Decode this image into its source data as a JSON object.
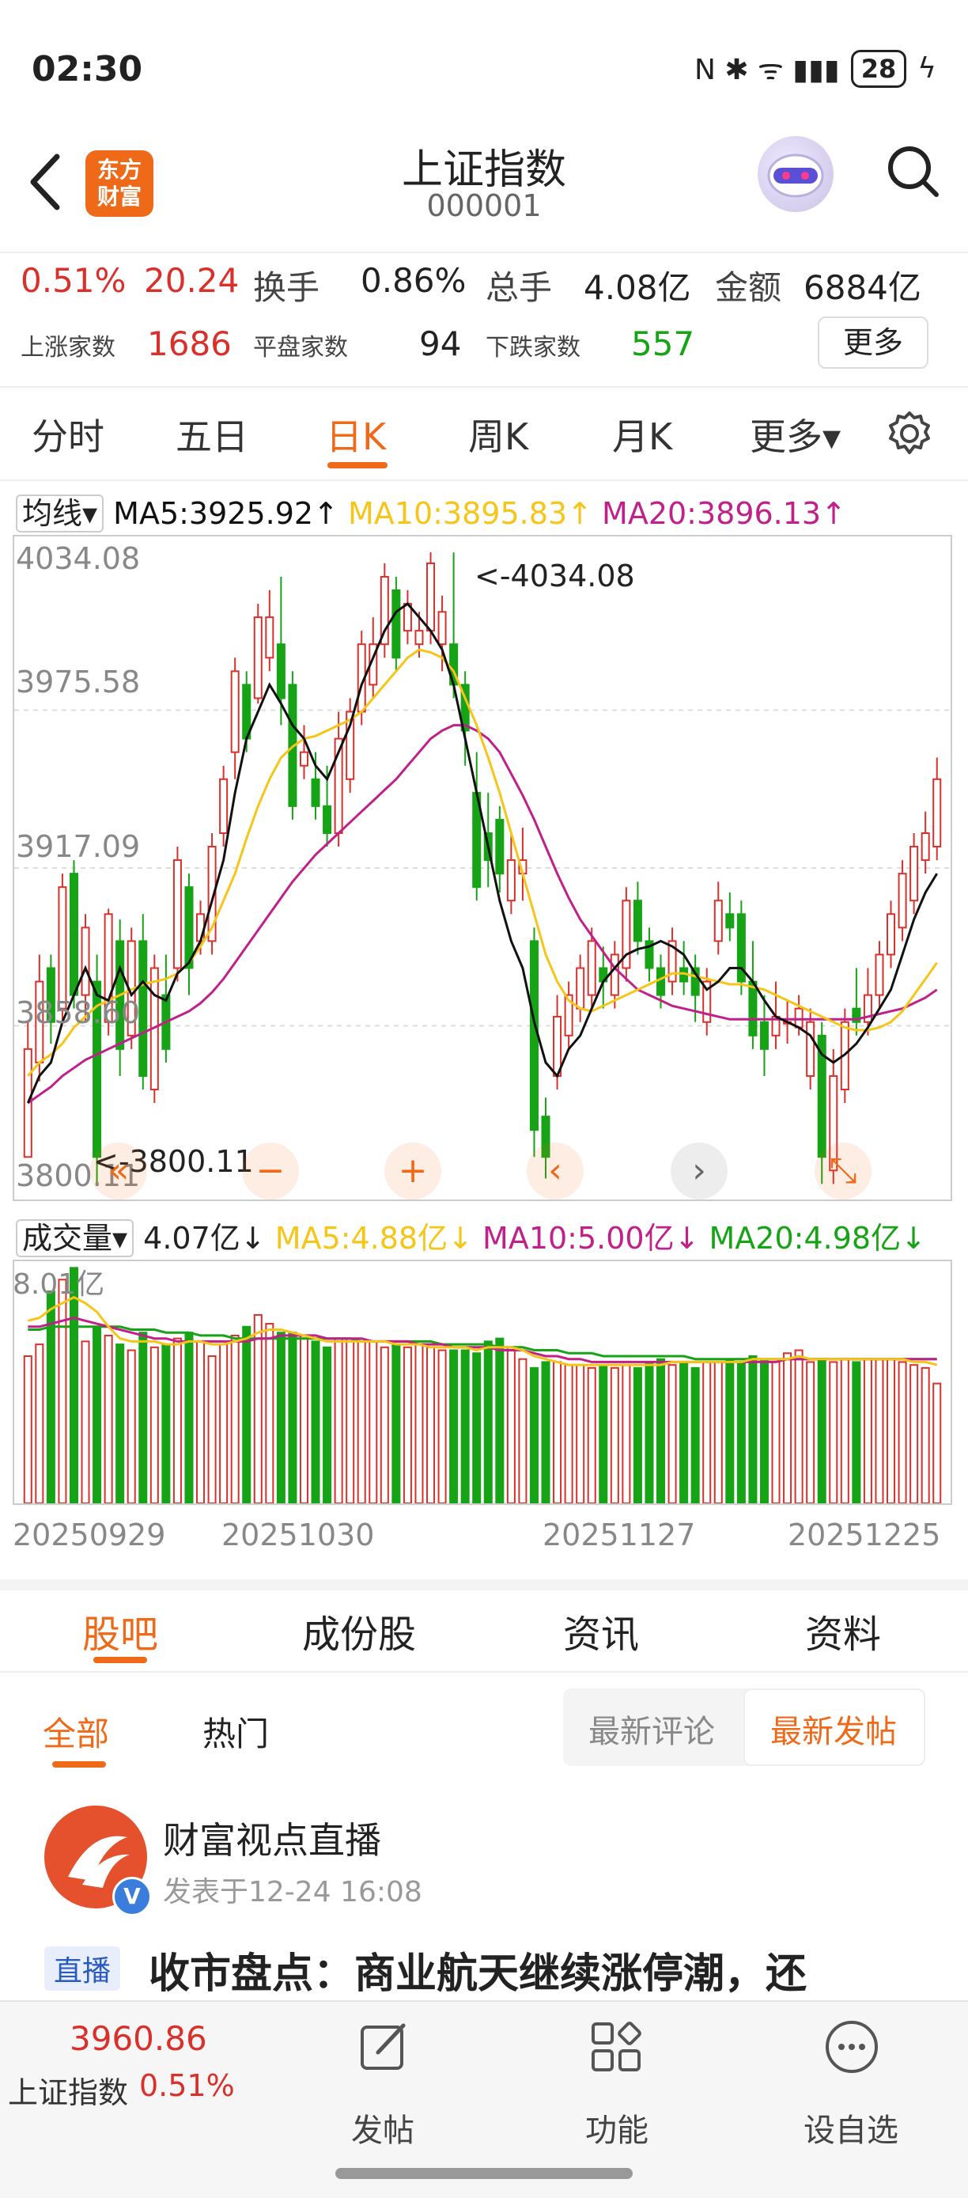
{
  "status_bar": {
    "time": "02:30",
    "signal_icons": "N ✱ ᯤ ▮▮▮",
    "battery": "28",
    "charging": "ϟ"
  },
  "header": {
    "back_icon": "chevron-left-icon",
    "logo_text": "东方\n财富",
    "title": "上证指数",
    "code": "000001"
  },
  "stats": {
    "change_pct": "0.51%",
    "change_val": "20.24",
    "turnover_label": "换手",
    "turnover": "0.86%",
    "volume_label": "总手",
    "volume": "4.08亿",
    "amount_label": "金额",
    "amount": "6884亿",
    "up_label": "上涨家数",
    "up_count": "1686",
    "flat_label": "平盘家数",
    "flat_count": "94",
    "down_label": "下跌家数",
    "down_count": "557",
    "more_button": "更多"
  },
  "period_tabs": [
    "分时",
    "五日",
    "日K",
    "周K",
    "月K",
    "更多▾"
  ],
  "ma_legend": {
    "selector": "均线▾",
    "ma5": "MA5:3925.92↑",
    "ma10": "MA10:3895.83↑",
    "ma20": "MA20:3896.13↑"
  },
  "vol_legend": {
    "selector": "成交量▾",
    "value": "4.07亿↓",
    "ma5": "MA5:4.88亿↓",
    "ma10": "MA10:5.00亿↓",
    "ma20": "MA20:4.98亿↓"
  },
  "colors": {
    "up": "#d9302b",
    "down": "#16a316",
    "ma5": "#111111",
    "ma10": "#f5c518",
    "ma20": "#c0208a",
    "accent": "#ee6a19"
  },
  "chart_data": {
    "type": "candlestick",
    "y_axis_labels": [
      "4034.08",
      "3975.58",
      "3917.09",
      "3858.60",
      "3800.11"
    ],
    "ylim": [
      3800.11,
      4034.08
    ],
    "max_annotation": "<-4034.08",
    "min_annotation": "<-3800.11",
    "x_labels": [
      "20250929",
      "20251030",
      "20251127",
      "20251225"
    ],
    "candles": [
      [
        3810,
        3850,
        3815,
        3860
      ],
      [
        3845,
        3875,
        3838,
        3885
      ],
      [
        3880,
        3860,
        3852,
        3885
      ],
      [
        3865,
        3910,
        3860,
        3915
      ],
      [
        3915,
        3870,
        3865,
        3920
      ],
      [
        3870,
        3895,
        3860,
        3900
      ],
      [
        3875,
        3810,
        3800,
        3885
      ],
      [
        3860,
        3900,
        3855,
        3902
      ],
      [
        3890,
        3850,
        3840,
        3898
      ],
      [
        3855,
        3890,
        3850,
        3895
      ],
      [
        3890,
        3840,
        3835,
        3900
      ],
      [
        3835,
        3880,
        3830,
        3885
      ],
      [
        3870,
        3850,
        3845,
        3885
      ],
      [
        3880,
        3920,
        3875,
        3925
      ],
      [
        3910,
        3880,
        3870,
        3915
      ],
      [
        3890,
        3900,
        3885,
        3905
      ],
      [
        3890,
        3925,
        3885,
        3930
      ],
      [
        3930,
        3950,
        3925,
        3955
      ],
      [
        3960,
        3990,
        3950,
        3995
      ],
      [
        3985,
        3965,
        3960,
        3990
      ],
      [
        3980,
        4010,
        3978,
        4015
      ],
      [
        3995,
        4010,
        3990,
        4020
      ],
      [
        4000,
        3980,
        3970,
        4025
      ],
      [
        3985,
        3940,
        3935,
        3990
      ],
      [
        3955,
        3960,
        3950,
        3970
      ],
      [
        3950,
        3940,
        3935,
        3960
      ],
      [
        3940,
        3930,
        3925,
        3955
      ],
      [
        3930,
        3965,
        3925,
        3975
      ],
      [
        3950,
        3975,
        3945,
        3980
      ],
      [
        3975,
        4000,
        3970,
        4005
      ],
      [
        3985,
        4000,
        3980,
        4010
      ],
      [
        4000,
        4025,
        3995,
        4030
      ],
      [
        4020,
        3995,
        3990,
        4025
      ],
      [
        4005,
        4015,
        4000,
        4020
      ],
      [
        4000,
        4005,
        3995,
        4012
      ],
      [
        4005,
        4030,
        4000,
        4034.08
      ],
      [
        4000,
        4012,
        3990,
        4018
      ],
      [
        4000,
        3985,
        3980,
        4034
      ],
      [
        3985,
        3968,
        3955,
        3990
      ],
      [
        3945,
        3910,
        3905,
        3960
      ],
      [
        3930,
        3920,
        3910,
        3945
      ],
      [
        3935,
        3915,
        3908,
        3940
      ],
      [
        3905,
        3920,
        3900,
        3930
      ],
      [
        3915,
        3920,
        3905,
        3932
      ],
      [
        3890,
        3820,
        3810,
        3895
      ],
      [
        3825,
        3810,
        3802,
        3832
      ],
      [
        3840,
        3862,
        3835,
        3870
      ],
      [
        3855,
        3870,
        3850,
        3875
      ],
      [
        3865,
        3880,
        3860,
        3885
      ],
      [
        3870,
        3890,
        3865,
        3895
      ],
      [
        3880,
        3875,
        3865,
        3888
      ],
      [
        3870,
        3885,
        3865,
        3890
      ],
      [
        3880,
        3905,
        3875,
        3910
      ],
      [
        3905,
        3890,
        3885,
        3912
      ],
      [
        3890,
        3880,
        3875,
        3895
      ],
      [
        3880,
        3870,
        3865,
        3885
      ],
      [
        3875,
        3890,
        3870,
        3895
      ],
      [
        3880,
        3875,
        3870,
        3890
      ],
      [
        3880,
        3870,
        3860,
        3885
      ],
      [
        3860,
        3875,
        3855,
        3880
      ],
      [
        3890,
        3905,
        3885,
        3912
      ],
      [
        3900,
        3895,
        3890,
        3908
      ],
      [
        3900,
        3875,
        3870,
        3905
      ],
      [
        3875,
        3855,
        3850,
        3890
      ],
      [
        3860,
        3850,
        3840,
        3870
      ],
      [
        3855,
        3862,
        3850,
        3875
      ],
      [
        3860,
        3860,
        3852,
        3868
      ],
      [
        3858,
        3865,
        3855,
        3870
      ],
      [
        3840,
        3860,
        3835,
        3865
      ],
      [
        3855,
        3810,
        3800,
        3860
      ],
      [
        3805,
        3840,
        3800,
        3850
      ],
      [
        3835,
        3860,
        3830,
        3865
      ],
      [
        3865,
        3860,
        3855,
        3880
      ],
      [
        3860,
        3870,
        3855,
        3880
      ],
      [
        3870,
        3885,
        3865,
        3890
      ],
      [
        3885,
        3900,
        3880,
        3905
      ],
      [
        3895,
        3915,
        3890,
        3920
      ],
      [
        3905,
        3925,
        3900,
        3930
      ],
      [
        3920,
        3930,
        3915,
        3938
      ],
      [
        3925,
        3950,
        3920,
        3958
      ]
    ],
    "ma5": [
      3830,
      3840,
      3845,
      3860,
      3870,
      3880,
      3870,
      3868,
      3880,
      3870,
      3875,
      3870,
      3868,
      3878,
      3882,
      3890,
      3905,
      3920,
      3945,
      3965,
      3975,
      3985,
      3978,
      3970,
      3965,
      3955,
      3950,
      3960,
      3970,
      3985,
      3995,
      4005,
      4012,
      4015,
      4010,
      4005,
      3998,
      3985,
      3965,
      3945,
      3925,
      3905,
      3890,
      3880,
      3860,
      3845,
      3840,
      3850,
      3855,
      3865,
      3875,
      3880,
      3885,
      3887,
      3888,
      3890,
      3888,
      3885,
      3878,
      3872,
      3875,
      3880,
      3880,
      3875,
      3868,
      3862,
      3860,
      3858,
      3855,
      3848,
      3845,
      3848,
      3852,
      3858,
      3865,
      3872,
      3885,
      3898,
      3908,
      3915
    ],
    "ma10": [
      3840,
      3845,
      3848,
      3852,
      3858,
      3862,
      3866,
      3868,
      3870,
      3872,
      3874,
      3875,
      3876,
      3878,
      3882,
      3888,
      3895,
      3905,
      3915,
      3928,
      3940,
      3950,
      3958,
      3962,
      3965,
      3966,
      3968,
      3970,
      3972,
      3975,
      3980,
      3985,
      3990,
      3995,
      3998,
      3997,
      3995,
      3990,
      3980,
      3970,
      3958,
      3945,
      3930,
      3915,
      3900,
      3885,
      3875,
      3868,
      3865,
      3864,
      3866,
      3868,
      3870,
      3872,
      3874,
      3876,
      3878,
      3878,
      3877,
      3876,
      3875,
      3874,
      3874,
      3873,
      3872,
      3870,
      3868,
      3866,
      3864,
      3862,
      3860,
      3858,
      3857,
      3857,
      3858,
      3860,
      3864,
      3870,
      3876,
      3882
    ],
    "ma20": [
      3830,
      3833,
      3836,
      3840,
      3843,
      3846,
      3848,
      3850,
      3852,
      3854,
      3856,
      3858,
      3860,
      3862,
      3864,
      3867,
      3871,
      3876,
      3882,
      3888,
      3894,
      3900,
      3906,
      3912,
      3917,
      3922,
      3926,
      3930,
      3934,
      3938,
      3942,
      3946,
      3950,
      3955,
      3960,
      3965,
      3968,
      3970,
      3970,
      3968,
      3965,
      3960,
      3952,
      3944,
      3935,
      3925,
      3915,
      3906,
      3898,
      3892,
      3886,
      3880,
      3876,
      3872,
      3870,
      3868,
      3866,
      3865,
      3864,
      3863,
      3862,
      3861,
      3861,
      3861,
      3861,
      3861,
      3861,
      3861,
      3861,
      3861,
      3861,
      3861,
      3861,
      3862,
      3863,
      3864,
      3865,
      3867,
      3869,
      3872
    ],
    "volume_axis_label": "8.01亿",
    "volume": [
      5.0,
      5.4,
      7.2,
      7.6,
      8.0,
      5.5,
      6.0,
      5.7,
      5.4,
      5.2,
      5.8,
      5.3,
      5.4,
      5.6,
      5.8,
      5.5,
      5.0,
      5.4,
      5.7,
      6.0,
      6.4,
      6.1,
      5.8,
      5.8,
      5.7,
      5.5,
      5.3,
      5.6,
      5.6,
      5.5,
      5.5,
      5.3,
      5.4,
      5.3,
      5.4,
      5.3,
      5.2,
      5.2,
      5.2,
      5.1,
      5.5,
      5.6,
      5.3,
      4.9,
      4.6,
      4.8,
      4.8,
      4.7,
      4.7,
      4.6,
      4.7,
      4.6,
      4.7,
      4.6,
      4.8,
      4.9,
      4.7,
      4.8,
      4.6,
      4.8,
      4.8,
      4.9,
      4.8,
      5.0,
      4.9,
      4.8,
      5.1,
      5.2,
      4.8,
      4.9,
      4.8,
      4.9,
      4.8,
      4.9,
      4.9,
      4.9,
      4.8,
      4.7,
      4.6,
      4.07
    ],
    "vol_ma5": [
      6.2,
      6.3,
      6.6,
      6.8,
      7.0,
      6.8,
      6.5,
      6.0,
      5.6,
      5.5,
      5.5,
      5.5,
      5.4,
      5.4,
      5.5,
      5.5,
      5.4,
      5.4,
      5.5,
      5.6,
      5.8,
      5.9,
      5.9,
      5.8,
      5.7,
      5.6,
      5.5,
      5.5,
      5.5,
      5.5,
      5.5,
      5.5,
      5.4,
      5.4,
      5.4,
      5.3,
      5.3,
      5.3,
      5.3,
      5.2,
      5.3,
      5.3,
      5.3,
      5.2,
      5.0,
      4.9,
      4.8,
      4.7,
      4.7,
      4.7,
      4.7,
      4.7,
      4.7,
      4.7,
      4.7,
      4.7,
      4.8,
      4.8,
      4.8,
      4.8,
      4.8,
      4.8,
      4.8,
      4.9,
      4.9,
      4.9,
      4.9,
      5.0,
      4.9,
      4.9,
      4.9,
      4.9,
      4.9,
      4.9,
      4.9,
      4.9,
      4.9,
      4.8,
      4.8,
      4.7
    ],
    "vol_ma10": [
      6.0,
      6.0,
      6.1,
      6.2,
      6.3,
      6.2,
      6.1,
      6.0,
      5.9,
      5.8,
      5.7,
      5.6,
      5.6,
      5.5,
      5.5,
      5.5,
      5.5,
      5.5,
      5.5,
      5.5,
      5.6,
      5.6,
      5.7,
      5.7,
      5.7,
      5.7,
      5.6,
      5.6,
      5.6,
      5.6,
      5.5,
      5.5,
      5.5,
      5.5,
      5.4,
      5.4,
      5.4,
      5.3,
      5.3,
      5.3,
      5.3,
      5.2,
      5.2,
      5.2,
      5.1,
      5.0,
      5.0,
      4.9,
      4.9,
      4.8,
      4.8,
      4.8,
      4.8,
      4.8,
      4.8,
      4.8,
      4.8,
      4.8,
      4.8,
      4.8,
      4.8,
      4.8,
      4.8,
      4.8,
      4.8,
      4.8,
      4.9,
      4.9,
      4.9,
      4.9,
      4.9,
      4.9,
      4.9,
      4.9,
      4.9,
      4.9,
      4.9,
      4.9,
      4.9,
      4.9
    ],
    "vol_ma20": [
      5.9,
      5.9,
      6.0,
      6.0,
      6.0,
      6.0,
      6.0,
      6.0,
      6.0,
      5.9,
      5.9,
      5.9,
      5.8,
      5.8,
      5.8,
      5.7,
      5.7,
      5.7,
      5.6,
      5.6,
      5.6,
      5.6,
      5.6,
      5.6,
      5.6,
      5.6,
      5.6,
      5.6,
      5.6,
      5.5,
      5.5,
      5.5,
      5.5,
      5.5,
      5.5,
      5.5,
      5.4,
      5.4,
      5.4,
      5.4,
      5.4,
      5.3,
      5.3,
      5.3,
      5.2,
      5.2,
      5.2,
      5.1,
      5.1,
      5.1,
      5.0,
      5.0,
      5.0,
      5.0,
      5.0,
      5.0,
      5.0,
      5.0,
      4.9,
      4.9,
      4.9,
      4.9,
      4.9,
      4.9,
      4.9,
      4.9,
      4.9,
      4.9,
      4.9,
      4.9,
      4.9,
      4.9,
      4.9,
      4.9,
      4.9,
      4.9,
      4.9,
      4.9,
      4.9,
      4.9
    ]
  },
  "chart_nav": {
    "rewind": "«",
    "zoom_out": "−",
    "zoom_in": "+",
    "prev": "‹",
    "next": "›",
    "fullscreen": "⤡"
  },
  "section_tabs": [
    "股吧",
    "成份股",
    "资讯",
    "资料"
  ],
  "sub_tabs": [
    "全部",
    "热门"
  ],
  "sort_options": [
    "最新评论",
    "最新发帖"
  ],
  "post": {
    "author": "财富视点直播",
    "time": "发表于12-24 16:08",
    "tag": "直播",
    "headline": "收市盘点：商业航天继续涨停潮，还"
  },
  "bottom_bar": {
    "index_price": "3960.86",
    "index_name": "上证指数",
    "index_change": "0.51%",
    "post_label": "发帖",
    "func_label": "功能",
    "fav_label": "设自选"
  }
}
